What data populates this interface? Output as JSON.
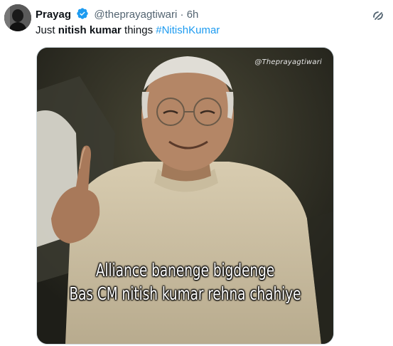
{
  "author": {
    "name": "Prayag",
    "handle": "@theprayagtiwari",
    "separator": "·",
    "time": "6h"
  },
  "icons": {
    "verified": "verified-badge-icon",
    "grok": "grok-icon",
    "avatar": "profile-avatar"
  },
  "tweet": {
    "text_prefix": "Just ",
    "text_bold": "nitish kumar",
    "text_mid": " things ",
    "hashtag": "#NitishKumar"
  },
  "media": {
    "watermark": "@Theprayagtiwari",
    "caption_line1": "Alliance banenge bigdenge",
    "caption_line2": "Bas CM nitish kumar rehna chahiye"
  },
  "colors": {
    "link": "#1d9bf0",
    "secondary_text": "#536471",
    "primary_text": "#0f1419",
    "verified": "#1d9bf0"
  }
}
